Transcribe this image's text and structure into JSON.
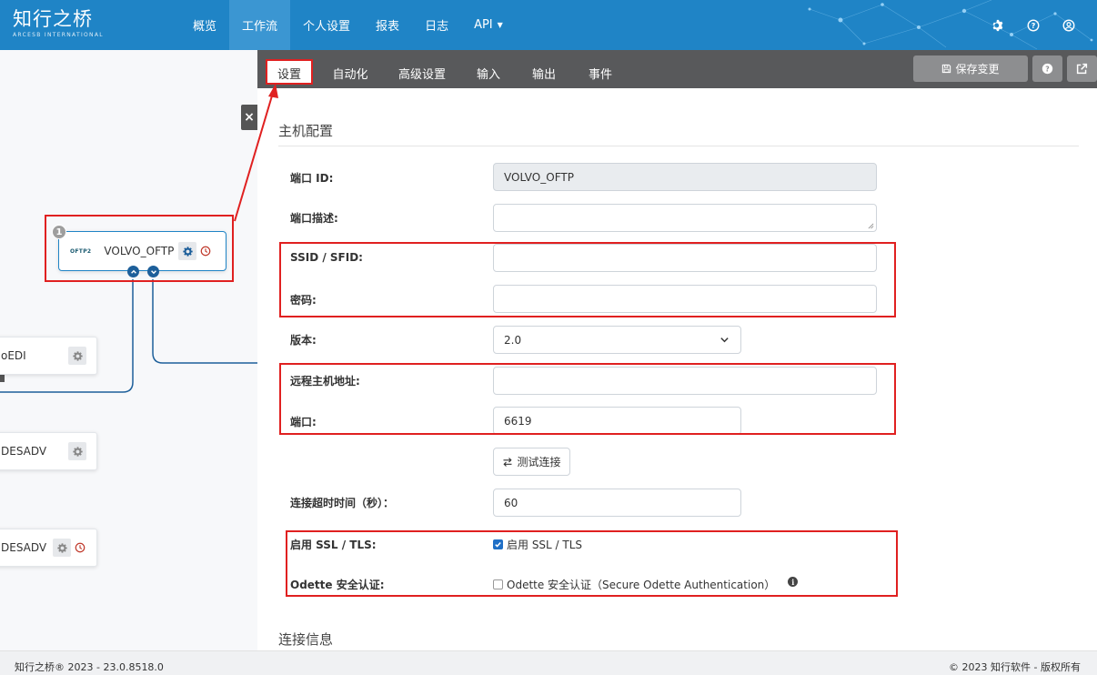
{
  "brand": {
    "name": "知行之桥",
    "subtitle": "ARCESB INTERNATIONAL"
  },
  "nav": {
    "items": [
      "概览",
      "工作流",
      "个人设置",
      "报表",
      "日志",
      "API"
    ],
    "active": "工作流"
  },
  "canvas": {
    "close_label": "×",
    "main_node": {
      "number": "1",
      "logo_text": "OFTP2",
      "label": "VOLVO_OFTP"
    },
    "nodes": [
      "oEDI",
      "DESADV",
      "DESADV"
    ]
  },
  "tabs": [
    "设置",
    "自动化",
    "高级设置",
    "输入",
    "输出",
    "事件"
  ],
  "toolbar": {
    "save_label": "保存变更"
  },
  "section": {
    "host_config": "主机配置",
    "connection_info": "连接信息"
  },
  "form": {
    "port_id": {
      "label": "端口 ID:",
      "value": "VOLVO_OFTP"
    },
    "port_desc": {
      "label": "端口描述:",
      "value": ""
    },
    "ssid": {
      "label": "SSID / SFID:",
      "value": ""
    },
    "password": {
      "label": "密码:",
      "value": ""
    },
    "version": {
      "label": "版本:",
      "value": "2.0"
    },
    "remote_host": {
      "label": "远程主机地址:",
      "value": ""
    },
    "port": {
      "label": "端口:",
      "value": "6619"
    },
    "test_label": "测试连接",
    "timeout": {
      "label": "连接超时时间（秒）：",
      "value": "60"
    },
    "ssl": {
      "label": "启用 SSL / TLS:",
      "checkbox_label": "启用 SSL / TLS",
      "checked": true
    },
    "odette": {
      "label": "Odette 安全认证:",
      "checkbox_label": "Odette 安全认证（Secure Odette Authentication）",
      "checked": false
    }
  },
  "footer": {
    "left": "知行之桥® 2023 - 23.0.8518.0",
    "right": "© 2023 知行软件 - 版权所有"
  },
  "colors": {
    "nav_bg": "#1f84c6",
    "tab_bar_bg": "#58595b",
    "highlight": "#e02020",
    "accent": "#1f6fc6"
  }
}
